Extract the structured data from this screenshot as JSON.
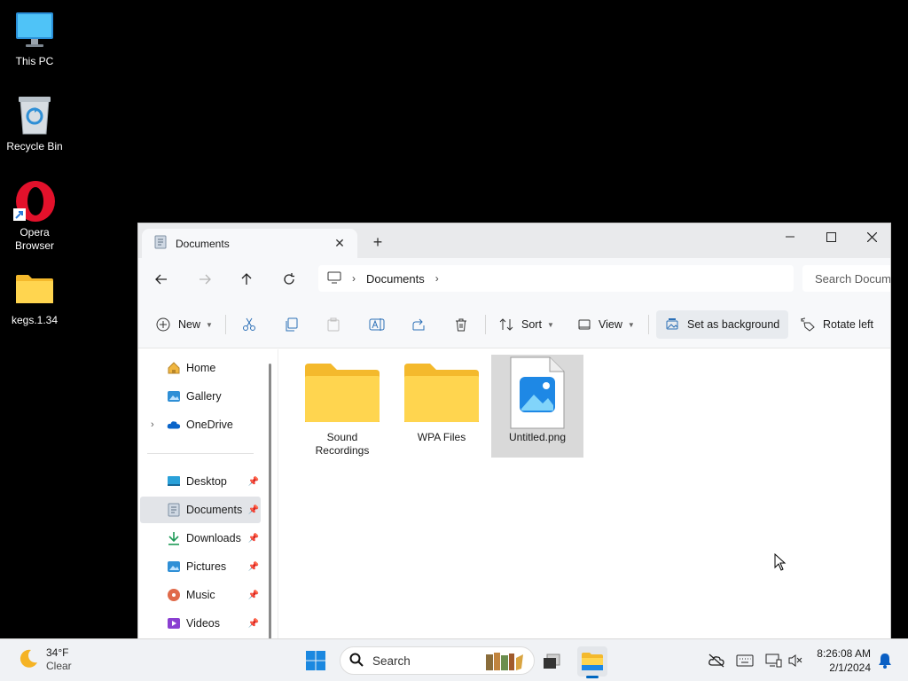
{
  "desktop": {
    "icons": [
      {
        "label": "This PC"
      },
      {
        "label": "Recycle Bin"
      },
      {
        "label": "Opera\nBrowser"
      },
      {
        "label": "kegs.1.34"
      }
    ]
  },
  "window": {
    "tab_title": "Documents",
    "tab_close": "✕",
    "new_tab": "+",
    "breadcrumb": [
      "Documents"
    ],
    "search_placeholder": "Search Documents",
    "toolbar": {
      "new": "New",
      "sort": "Sort",
      "view": "View",
      "set_background": "Set as background",
      "rotate_left": "Rotate left"
    },
    "nav": {
      "top": [
        {
          "label": "Home",
          "icon": "home-icon"
        },
        {
          "label": "Gallery",
          "icon": "gallery-icon"
        },
        {
          "label": "OneDrive",
          "icon": "onedrive-icon"
        }
      ],
      "quick": [
        {
          "label": "Desktop",
          "icon": "desktop-icon"
        },
        {
          "label": "Documents",
          "icon": "documents-icon"
        },
        {
          "label": "Downloads",
          "icon": "downloads-icon"
        },
        {
          "label": "Pictures",
          "icon": "pictures-icon"
        },
        {
          "label": "Music",
          "icon": "music-icon"
        },
        {
          "label": "Videos",
          "icon": "videos-icon"
        }
      ],
      "selected": "Documents"
    },
    "files": [
      {
        "name": "Sound\nRecordings",
        "type": "folder"
      },
      {
        "name": "WPA Files",
        "type": "folder"
      },
      {
        "name": "Untitled.png",
        "type": "image",
        "selected": true
      }
    ]
  },
  "taskbar": {
    "weather_temp": "34°F",
    "weather_desc": "Clear",
    "search_label": "Search",
    "time": "8:26:08 AM",
    "date": "2/1/2024"
  },
  "colors": {
    "accent": "#0067c0",
    "folder": "#f8c83a",
    "desktop_bg": "#000000"
  }
}
